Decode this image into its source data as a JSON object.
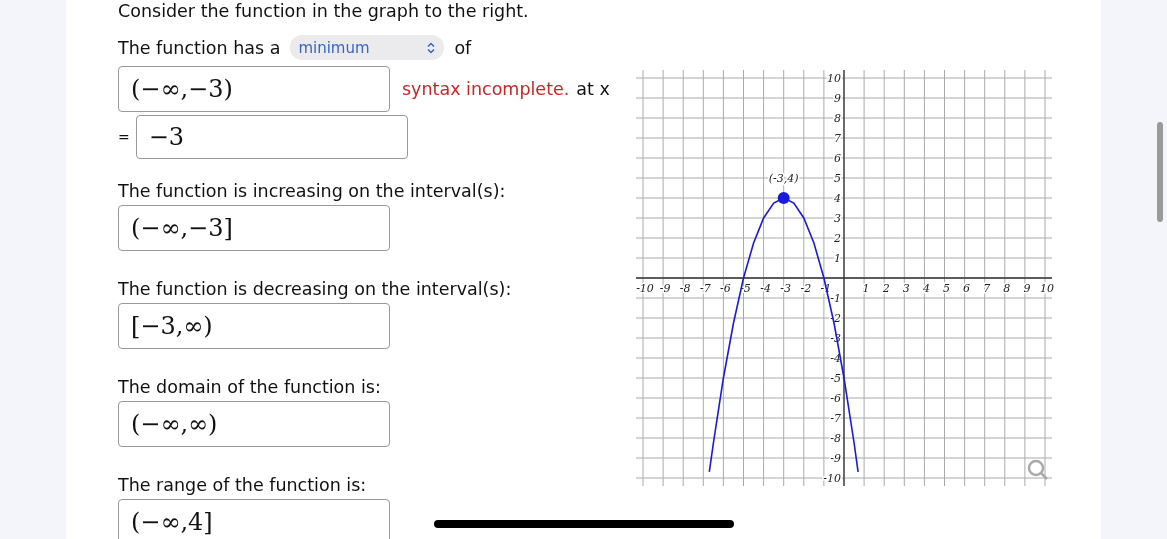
{
  "intro": "Consider the function in the graph to the right.",
  "extremum": {
    "before": "The function has a",
    "select": "minimum",
    "after": "of",
    "value": "(−∞,−3)",
    "feedback": "syntax incomplete.",
    "at": "at x",
    "equals": "=",
    "x_value": "−3"
  },
  "questions": [
    {
      "label": "The function is increasing on the interval(s):",
      "value": "(−∞,−3]"
    },
    {
      "label": "The function is decreasing on the interval(s):",
      "value": "[−3,∞)"
    },
    {
      "label": "The domain of the function is:",
      "value": "(−∞,∞)"
    },
    {
      "label": "The range of the function is:",
      "value": "(−∞,4]"
    }
  ],
  "graph": {
    "chart_data": {
      "type": "line",
      "x": [
        -6.7,
        -6.5,
        -6,
        -5.5,
        -5,
        -4.5,
        -4,
        -3.5,
        -3,
        -2.5,
        -2,
        -1.5,
        -1,
        -0.5,
        0,
        0.5,
        0.7
      ],
      "series": [
        {
          "color": "#1a1adb",
          "values": [
            -9.69,
            -8.25,
            -5,
            -2.25,
            0,
            1.75,
            3,
            3.75,
            4,
            3.75,
            3,
            1.75,
            0,
            -2.25,
            -5,
            -8.25,
            -9.69
          ]
        }
      ],
      "grid": true,
      "xlim": [
        -10,
        10
      ],
      "ylim": [
        -10,
        10
      ],
      "xticks": [
        -10,
        -9,
        -8,
        -7,
        -6,
        -5,
        -4,
        -3,
        -2,
        -1,
        1,
        2,
        3,
        4,
        5,
        6,
        7,
        8,
        9,
        10
      ],
      "yticks": [
        -10,
        -9,
        -8,
        -7,
        -6,
        -5,
        -4,
        -3,
        -2,
        -1,
        1,
        2,
        3,
        4,
        5,
        6,
        7,
        8,
        9,
        10
      ],
      "annotations": [
        {
          "x": -3,
          "y": 4,
          "text": "(-3,4)"
        }
      ]
    }
  }
}
